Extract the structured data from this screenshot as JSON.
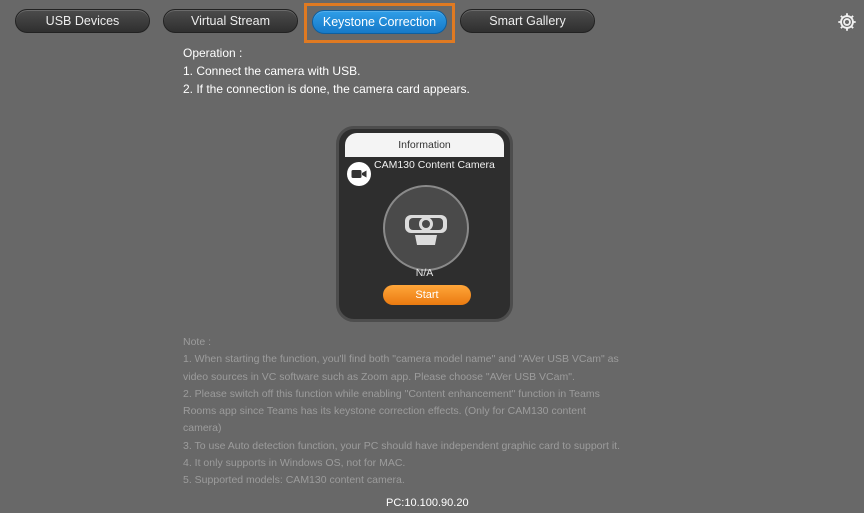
{
  "tabs": [
    {
      "label": "USB Devices"
    },
    {
      "label": "Virtual Stream"
    },
    {
      "label": "Keystone Correction"
    },
    {
      "label": "Smart Gallery"
    }
  ],
  "active_tab": "Keystone Correction",
  "icons": {
    "settings": "gear-icon",
    "camera_small": "video-camera-icon",
    "camera_large": "webcam-icon"
  },
  "colors": {
    "active_tab": "#1f8ad8",
    "highlight": "#e07a22",
    "start_button": "#f28c1f",
    "background": "#686868"
  },
  "operation": {
    "title": "Operation :",
    "steps": [
      "1. Connect the camera with USB.",
      "2. If the connection is done, the camera card appears."
    ]
  },
  "card": {
    "header": "Information",
    "camera_name": "CAM130 Content Camera",
    "status": "N/A",
    "start_label": "Start"
  },
  "notes": {
    "title": "Note :",
    "lines": [
      "1. When starting the function, you'll find both \"camera model name\" and \"AVer USB VCam\" as",
      "video sources in VC software such as Zoom app. Please choose \"AVer USB VCam\".",
      "2. Please switch off this function while enabling \"Content enhancement\" function in Teams",
      "Rooms app since Teams has its keystone correction effects. (Only for CAM130 content",
      "camera)",
      "3. To use Auto detection function, your PC should have independent graphic card to support it.",
      "4. It only supports in Windows OS, not for MAC.",
      "5. Supported models: CAM130 content camera."
    ]
  },
  "footer": {
    "pc_ip": "PC:10.100.90.20"
  }
}
